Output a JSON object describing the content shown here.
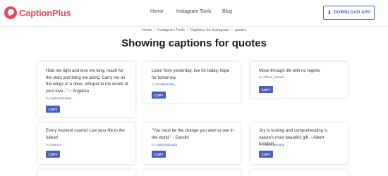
{
  "brand": {
    "name": "CaptionPlus"
  },
  "nav": {
    "home": "Home",
    "tools": "Instagram Tools",
    "blog": "Blog"
  },
  "download": {
    "label": "DOWNLOAD APP"
  },
  "breadcrumb": {
    "home": "Home",
    "tools": "Instagram Tools",
    "captions": "Captions for Instagram",
    "current": "quotes",
    "separator": "/"
  },
  "heading": "Showing captions for quotes",
  "by_prefix": "by",
  "copy_label": "COPY",
  "cards": [
    {
      "text": "Hold me tight and love me long, reach for the stars and bring me along. Carry me on the wings of a dove, whisper to me words of your love...\" ~ Angelisa",
      "user": "captionplusapp"
    },
    {
      "text": "Learn from yesterday, live for today, hope for tomorrow.",
      "user": "tzoughanakis_"
    },
    {
      "text": "Move through life with no regrets",
      "user": "official_simarle"
    },
    {
      "text": "Every moment counts! Live your life to the fullest!",
      "user": "zeproxo"
    },
    {
      "text": "\"You must be the change you wish to see in the world.\" - Gandhi",
      "user": "captionplusapp"
    },
    {
      "text": "Joy in looking and comprehending is nature's most beautiful gift. - Albert Einstein.",
      "user": "captionplusapp"
    }
  ],
  "colors": {
    "brand": "#e8495f",
    "accent": "#4a5fc1"
  }
}
